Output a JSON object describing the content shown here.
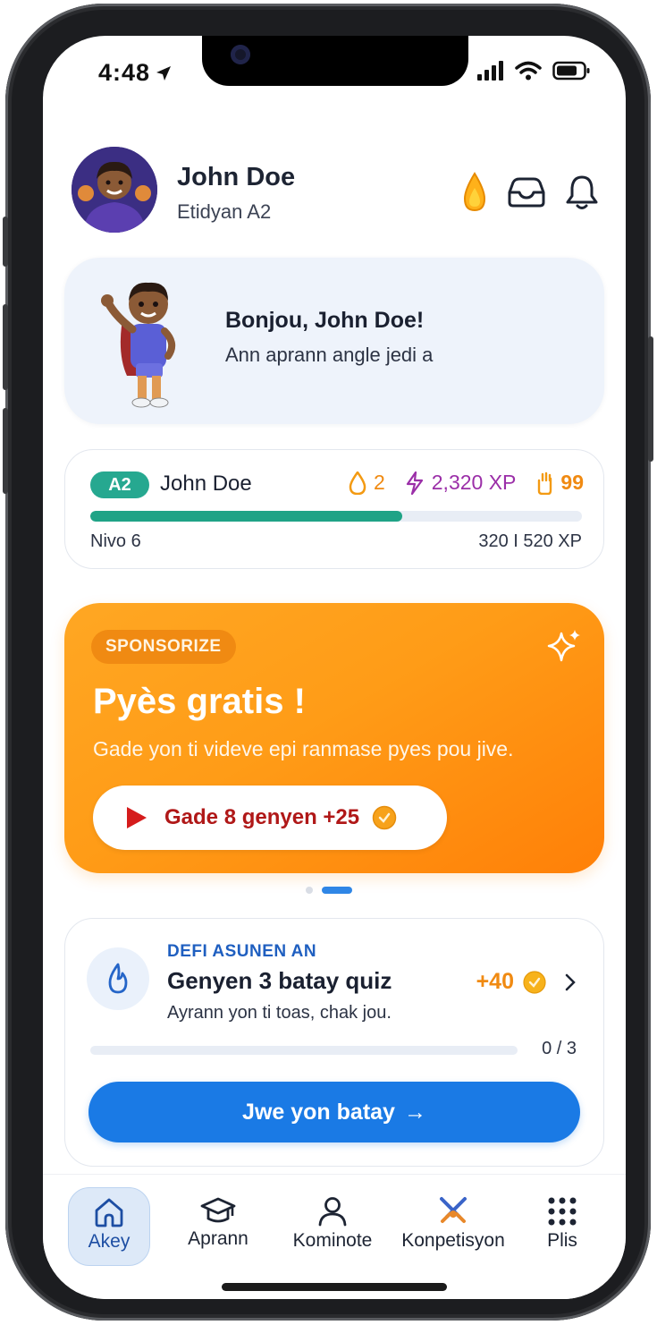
{
  "status": {
    "time": "4:48"
  },
  "profile": {
    "name": "John Doe",
    "level_label": "Etidyan A2"
  },
  "greeting": {
    "title": "Bonjou, John Doe!",
    "subtitle": "Ann aprann angle jedi a"
  },
  "stats": {
    "badge": "A2",
    "name": "John Doe",
    "streak": "2",
    "xp": "2,320 XP",
    "gems": "99",
    "progress": 0.635,
    "level": "Nivo 6",
    "xp_progress": "320 I 520 XP"
  },
  "promo": {
    "tag": "SPONSORIZE",
    "title": "Pyès gratis !",
    "subtitle": "Gade yon ti videve epi ranmase pyes pou jive.",
    "button_label": "Gade 8 genyen +25"
  },
  "carousel": {
    "active_index": 1,
    "count": 2
  },
  "challenge": {
    "kicker": "DEFI ASUNEN AN",
    "title": "Genyen 3 batay quiz",
    "subtitle": "Ayrann yon ti toas, chak jou.",
    "reward": "+40",
    "progress": 0,
    "count": "0 / 3",
    "button_label": "Jwe yon batay",
    "button_arrow": "→"
  },
  "tabs": [
    {
      "label": "Akey",
      "icon": "home-icon"
    },
    {
      "label": "Aprann",
      "icon": "graduation-cap-icon"
    },
    {
      "label": "Kominote",
      "icon": "person-icon"
    },
    {
      "label": "Konpetisyon",
      "icon": "crossed-swords-icon"
    },
    {
      "label": "Plis",
      "icon": "grid-dots-icon"
    }
  ],
  "colors": {
    "accent_blue": "#1a7ae5",
    "teal": "#26a890",
    "orange": "#ff9c17",
    "xp_purple": "#9b2fa8",
    "red": "#b01818"
  }
}
